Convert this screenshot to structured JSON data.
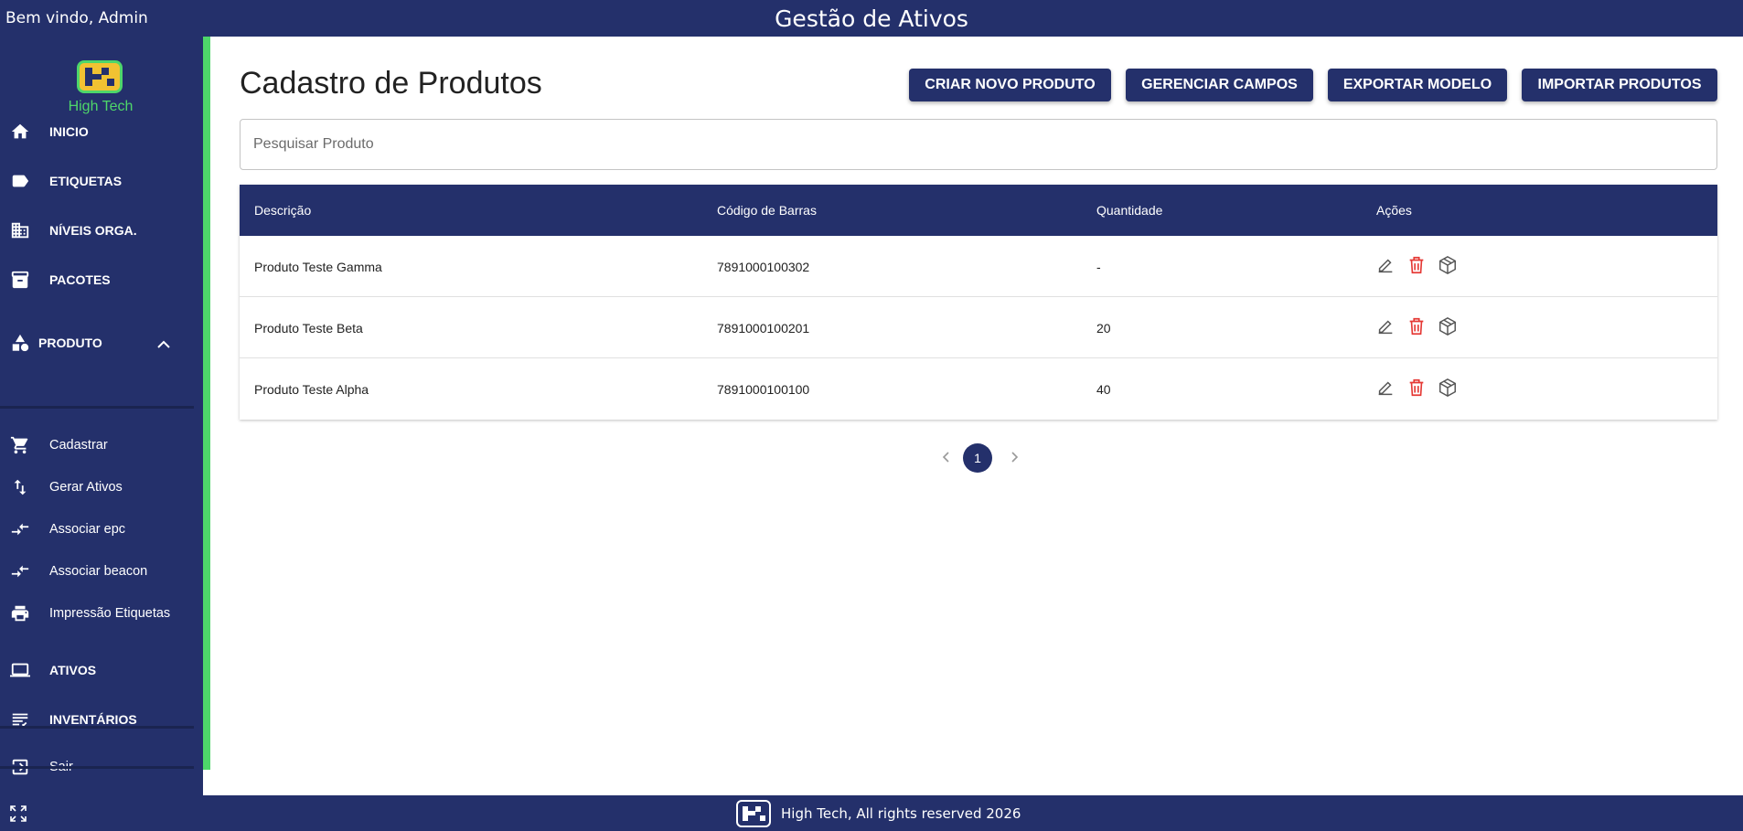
{
  "header": {
    "welcome": "Bem vindo, Admin",
    "title": "Gestão de Ativos"
  },
  "brand": {
    "logo_text": "High Tech",
    "logo_icon": "high-tech-logo",
    "accent": "#4ed66a",
    "primary": "#24306b"
  },
  "sidebar": {
    "items": [
      {
        "label": "INICIO",
        "icon": "home-icon"
      },
      {
        "label": "ETIQUETAS",
        "icon": "label-icon"
      },
      {
        "label": "NÍVEIS ORGA.",
        "icon": "building-icon"
      },
      {
        "label": "PACOTES",
        "icon": "archive-icon"
      }
    ],
    "group": {
      "label": "PRODUTO",
      "icon": "category-icon",
      "expanded": true
    },
    "subitems": [
      {
        "label": "Cadastrar",
        "icon": "cart-icon"
      },
      {
        "label": "Gerar Ativos",
        "icon": "swap-vert-icon"
      },
      {
        "label": "Associar epc",
        "icon": "compare-arrows-icon"
      },
      {
        "label": "Associar beacon",
        "icon": "compare-arrows-icon"
      },
      {
        "label": "Impressão Etiquetas",
        "icon": "print-icon"
      }
    ],
    "items2": [
      {
        "label": "ATIVOS",
        "icon": "laptop-icon"
      },
      {
        "label": "INVENTÁRIOS",
        "icon": "checklist-icon"
      }
    ],
    "logout": {
      "label": "Sair",
      "icon": "logout-icon"
    }
  },
  "main": {
    "title": "Cadastro de Produtos",
    "buttons": [
      "CRIAR NOVO PRODUTO",
      "GERENCIAR CAMPOS",
      "EXPORTAR MODELO",
      "IMPORTAR PRODUTOS"
    ],
    "search": {
      "placeholder": "Pesquisar Produto",
      "value": ""
    },
    "table": {
      "columns": [
        "Descrição",
        "Código de Barras",
        "Quantidade",
        "Ações"
      ],
      "rows": [
        {
          "descricao": "Produto Teste Gamma",
          "codigo": "7891000100302",
          "quantidade": "-"
        },
        {
          "descricao": "Produto Teste Beta",
          "codigo": "7891000100201",
          "quantidade": "20"
        },
        {
          "descricao": "Produto Teste Alpha",
          "codigo": "7891000100100",
          "quantidade": "40"
        }
      ],
      "action_icons": [
        "edit-icon",
        "delete-icon",
        "package-icon"
      ]
    },
    "pagination": {
      "current": "1"
    }
  },
  "footer": {
    "text": "High Tech, All rights reserved 2026"
  }
}
